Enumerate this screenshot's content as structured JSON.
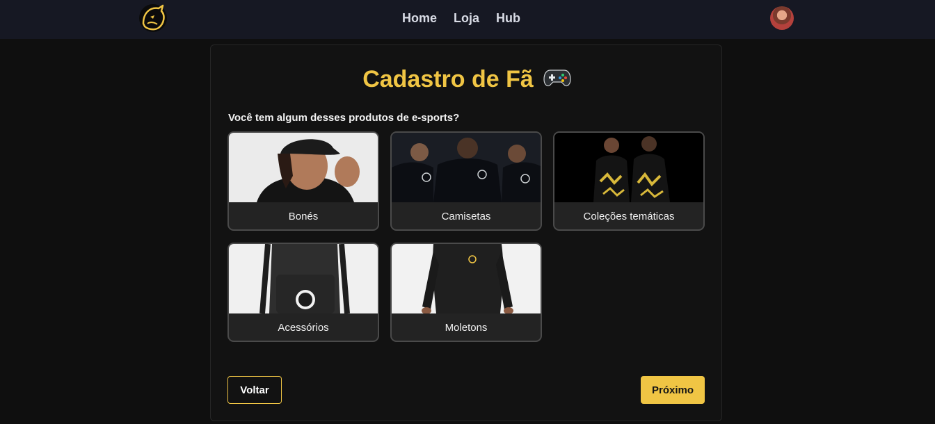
{
  "nav": {
    "logo_icon": "panther-logo-icon",
    "links": [
      "Home",
      "Loja",
      "Hub"
    ],
    "avatar_icon": "user-avatar"
  },
  "page": {
    "title": "Cadastro de Fã",
    "title_icon": "gamepad-icon",
    "question": "Você tem algum desses produtos de e-sports?"
  },
  "products": [
    {
      "label": "Bonés",
      "image": "cap-model-photo"
    },
    {
      "label": "Camisetas",
      "image": "team-jerseys-photo"
    },
    {
      "label": "Coleções temáticas",
      "image": "themed-collection-photo"
    },
    {
      "label": "Acessórios",
      "image": "backpack-photo"
    },
    {
      "label": "Moletons",
      "image": "hoodie-photo"
    }
  ],
  "actions": {
    "back_label": "Voltar",
    "next_label": "Próximo"
  },
  "colors": {
    "accent": "#f0c544",
    "navbar_bg": "#161823",
    "page_bg": "#0f0f0f",
    "card_bg": "#121212",
    "tile_bg": "#232323"
  }
}
